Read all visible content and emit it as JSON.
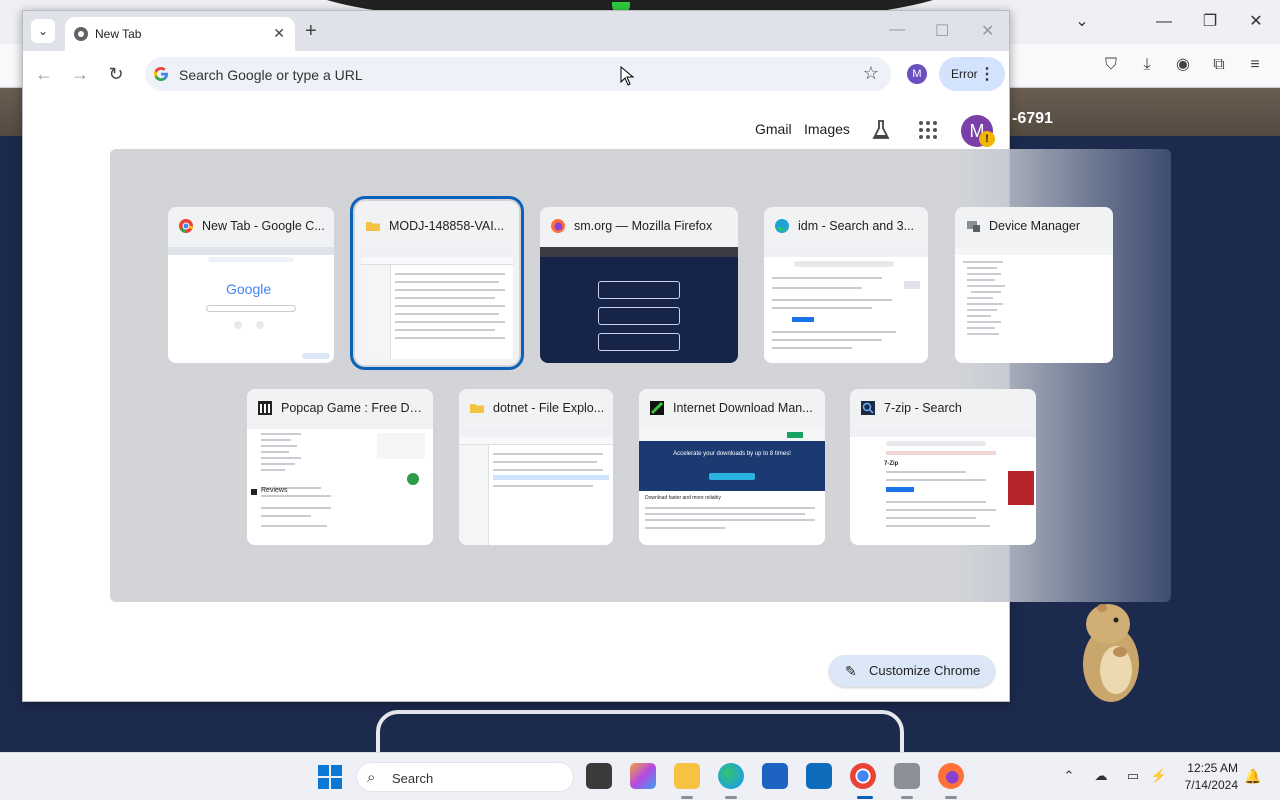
{
  "background": {
    "phone_fragment": "-6791"
  },
  "chrome": {
    "tab": {
      "title": "New Tab"
    },
    "omnibox": {
      "placeholder": "Search Google or type a URL"
    },
    "profile_initial": "M",
    "error_label": "Error",
    "ntp": {
      "gmail": "Gmail",
      "images": "Images",
      "avatar_initial": "M",
      "avatar_badge": "!",
      "customize_label": "Customize Chrome"
    }
  },
  "switcher": {
    "windows": [
      {
        "title": "New Tab - Google C...",
        "icon": "chrome-icon",
        "selected": false
      },
      {
        "title": "MODJ-148858-VAI...",
        "icon": "folder-icon",
        "selected": true
      },
      {
        "title": "sm.org — Mozilla Firefox",
        "icon": "firefox-icon",
        "selected": false
      },
      {
        "title": "idm - Search and 3...",
        "icon": "edge-icon",
        "selected": false
      },
      {
        "title": "Device Manager",
        "icon": "device-manager-icon",
        "selected": false
      },
      {
        "title": "Popcap Game : Free Do...",
        "icon": "archive-icon",
        "selected": false
      },
      {
        "title": "dotnet - File Explo...",
        "icon": "folder-icon",
        "selected": false
      },
      {
        "title": "Internet Download Man...",
        "icon": "idm-icon",
        "selected": false
      },
      {
        "title": "7-zip - Search",
        "icon": "search-app-icon",
        "selected": false
      }
    ],
    "thumb_google_logo": "Google",
    "thumb_idm_headline": "Accelerate your downloads by up to 8 times!",
    "thumb_idm_subhead": "Download faster and more reliably",
    "thumb_reviews": "Reviews",
    "thumb_7zip": "7-Zip"
  },
  "taskbar": {
    "search_label": "Search",
    "time": "12:25 AM",
    "date": "7/14/2024"
  }
}
